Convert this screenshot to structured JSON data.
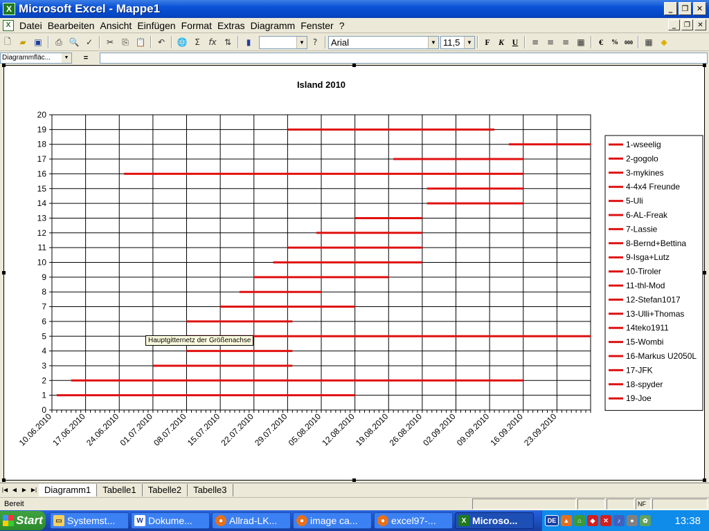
{
  "window": {
    "title": "Microsoft Excel - Mappe1",
    "app_icon": "excel-icon"
  },
  "menu": {
    "items": [
      "Datei",
      "Bearbeiten",
      "Ansicht",
      "Einfügen",
      "Format",
      "Extras",
      "Diagramm",
      "Fenster",
      "?"
    ]
  },
  "toolbar": {
    "font_name": "Arial",
    "font_size": "11,5",
    "bold_label": "F",
    "italic_label": "K",
    "underline_label": "U",
    "euro_label": "€",
    "percent_label": "%",
    "thousands_label": "000"
  },
  "formula": {
    "name_box": "Diagrammfläc...",
    "equals": "="
  },
  "tooltip": "Hauptgitternetz der Größenachse",
  "sheets": [
    "Diagramm1",
    "Tabelle1",
    "Tabelle2",
    "Tabelle3"
  ],
  "status": {
    "text": "Bereit",
    "nf": "NF"
  },
  "taskbar": {
    "start": "Start",
    "tasks": [
      "Systemst...",
      "Dokume...",
      "Allrad-LK...",
      "image ca...",
      "excel97-...",
      "Microso..."
    ],
    "lang": "DE",
    "clock": "13:38"
  },
  "chart_data": {
    "type": "bar",
    "title": "Island 2010",
    "ylim": [
      0,
      20
    ],
    "y_ticks": [
      0,
      1,
      2,
      3,
      4,
      5,
      6,
      7,
      8,
      9,
      10,
      11,
      12,
      13,
      14,
      15,
      16,
      17,
      18,
      19,
      20
    ],
    "xlim": [
      "2010-06-10",
      "2010-09-30"
    ],
    "x_tick_labels": [
      "10.06.2010",
      "17.06.2010",
      "24.06.2010",
      "01.07.2010",
      "08.07.2010",
      "15.07.2010",
      "22.07.2010",
      "29.07.2010",
      "05.08.2010",
      "12.08.2010",
      "19.08.2010",
      "26.08.2010",
      "02.09.2010",
      "09.09.2010",
      "16.09.2010",
      "23.09.2010"
    ],
    "grid": true,
    "legend_position": "right",
    "series_color": "#e01010",
    "series": [
      {
        "name": "1-wseelig",
        "y": 19,
        "start": "2010-07-29",
        "end": "2010-09-10"
      },
      {
        "name": "2-gogolo",
        "y": 18,
        "start": "2010-09-13",
        "end": "2010-09-30"
      },
      {
        "name": "3-mykines",
        "y": 17,
        "start": "2010-08-20",
        "end": "2010-09-16"
      },
      {
        "name": "4-4x4 Freunde",
        "y": 16,
        "start": "2010-06-25",
        "end": "2010-09-16"
      },
      {
        "name": "5-Uli",
        "y": 15,
        "start": "2010-08-27",
        "end": "2010-09-16"
      },
      {
        "name": "6-AL-Freak",
        "y": 14,
        "start": "2010-08-27",
        "end": "2010-09-16"
      },
      {
        "name": "7-Lassie",
        "y": 13,
        "start": "2010-08-12",
        "end": "2010-08-26"
      },
      {
        "name": "8-Bernd+Bettina",
        "y": 12,
        "start": "2010-08-04",
        "end": "2010-08-26"
      },
      {
        "name": "9-Isga+Lutz",
        "y": 11,
        "start": "2010-07-29",
        "end": "2010-08-26"
      },
      {
        "name": "10-Tiroler",
        "y": 10,
        "start": "2010-07-26",
        "end": "2010-08-26"
      },
      {
        "name": "11-thl-Mod",
        "y": 9,
        "start": "2010-07-22",
        "end": "2010-08-19"
      },
      {
        "name": "12-Stefan1017",
        "y": 8,
        "start": "2010-07-19",
        "end": "2010-08-05"
      },
      {
        "name": "13-Ulli+Thomas",
        "y": 7,
        "start": "2010-07-15",
        "end": "2010-08-12"
      },
      {
        "name": "14teko1911",
        "y": 6,
        "start": "2010-07-08",
        "end": "2010-07-30"
      },
      {
        "name": "15-Wombi",
        "y": 5,
        "start": "2010-07-08",
        "end": "2010-09-30"
      },
      {
        "name": "16-Markus U2050L",
        "y": 4,
        "start": "2010-07-08",
        "end": "2010-07-30"
      },
      {
        "name": "17-JFK",
        "y": 3,
        "start": "2010-07-01",
        "end": "2010-07-30"
      },
      {
        "name": "18-spyder",
        "y": 2,
        "start": "2010-06-14",
        "end": "2010-09-16"
      },
      {
        "name": "19-Joe",
        "y": 1,
        "start": "2010-06-11",
        "end": "2010-08-12"
      }
    ]
  }
}
